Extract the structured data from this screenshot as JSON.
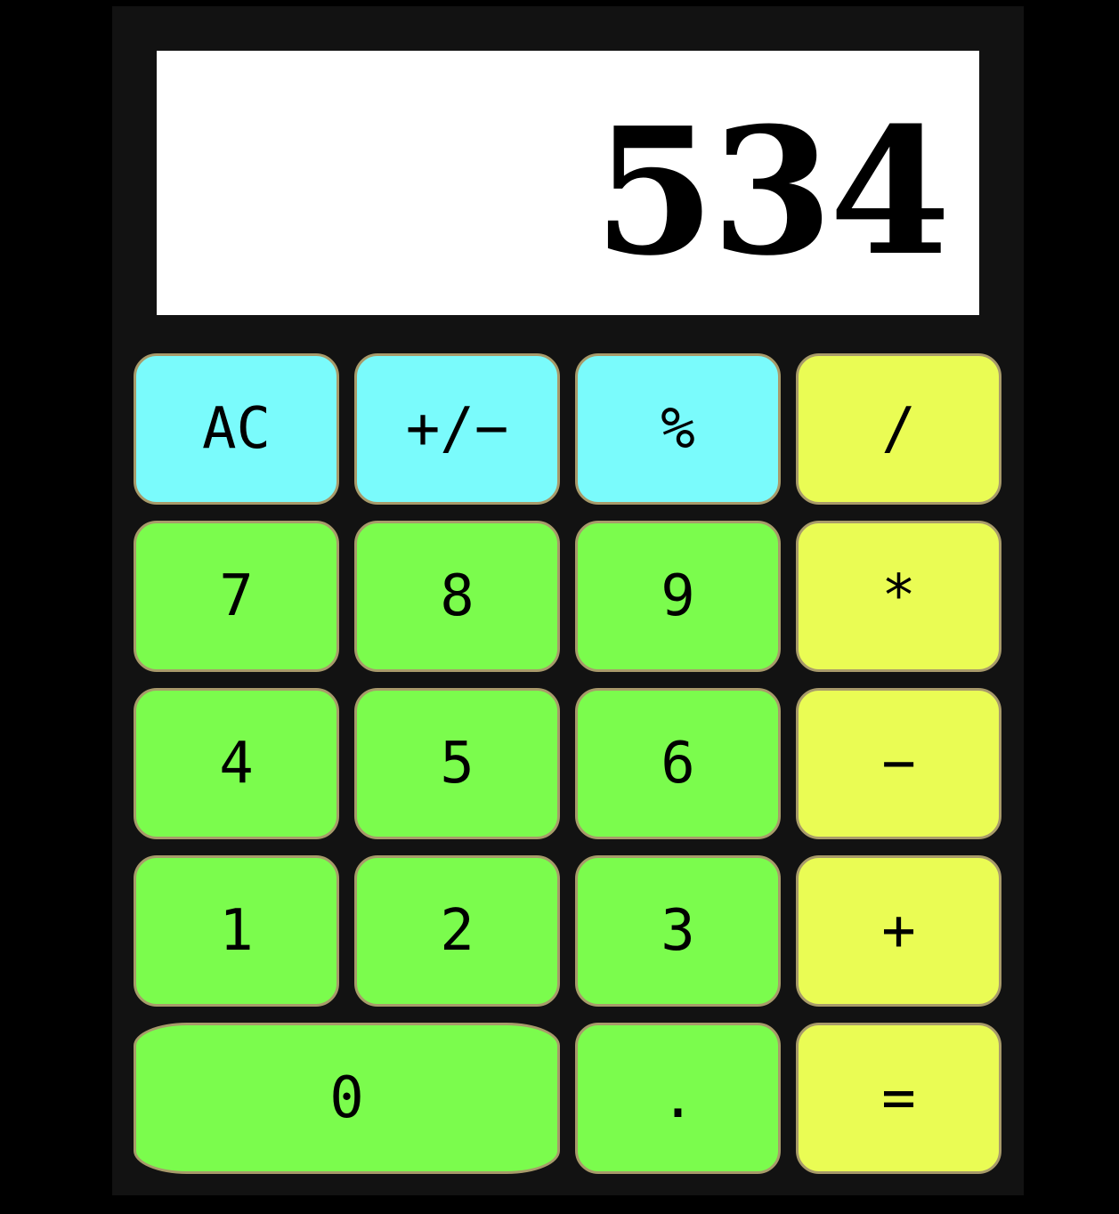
{
  "display": {
    "value": "534"
  },
  "keys": {
    "ac": "AC",
    "sign": "+/−",
    "percent": "%",
    "divide": "/",
    "seven": "7",
    "eight": "8",
    "nine": "9",
    "multiply": "*",
    "four": "4",
    "five": "5",
    "six": "6",
    "subtract": "−",
    "one": "1",
    "two": "2",
    "three": "3",
    "add": "+",
    "zero": "0",
    "decimal": ".",
    "equals": "="
  },
  "colors": {
    "background": "#000000",
    "body": "#121212",
    "display": "#ffffff",
    "function_key": "#7afbfc",
    "number_key": "#7bfc4d",
    "operator_key": "#eafc54",
    "key_border": "#a89a6a"
  }
}
